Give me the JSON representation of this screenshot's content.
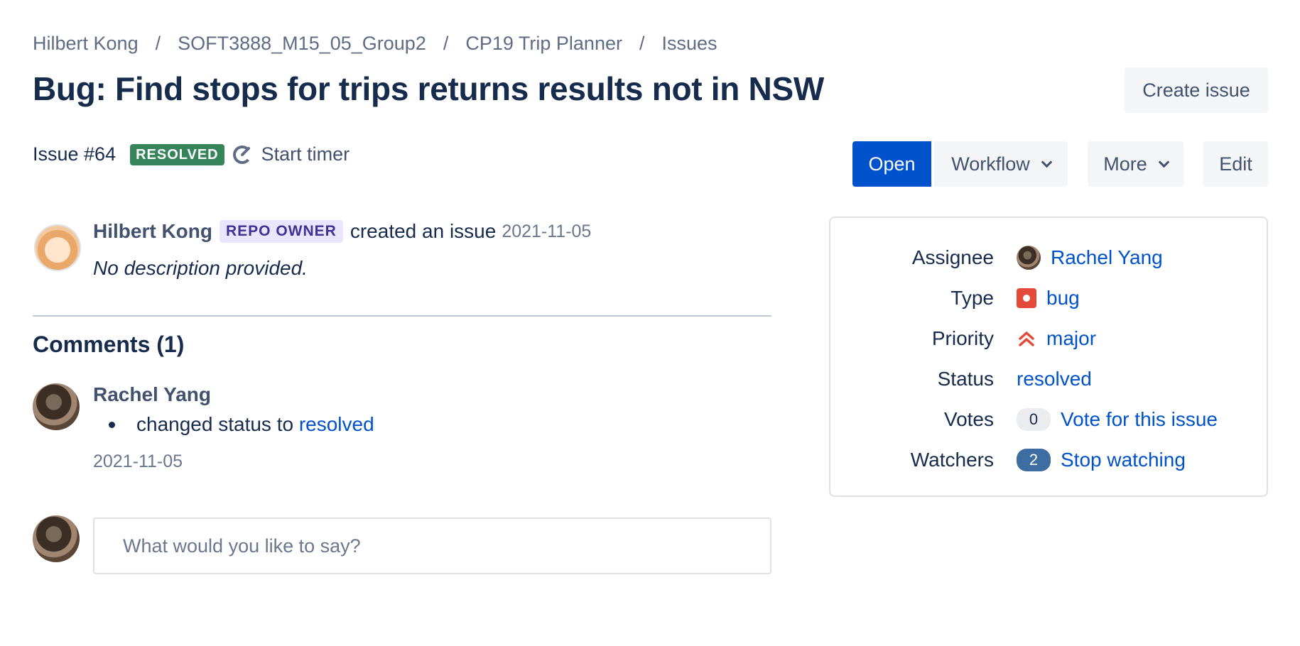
{
  "breadcrumb": [
    {
      "label": "Hilbert Kong"
    },
    {
      "label": "SOFT3888_M15_05_Group2"
    },
    {
      "label": "CP19 Trip Planner"
    },
    {
      "label": "Issues"
    }
  ],
  "breadcrumb_separator": "/",
  "issue": {
    "title": "Bug: Find stops for trips returns results not in NSW",
    "id_label": "Issue #64",
    "status_lozenge": "RESOLVED",
    "timer_label": "Start timer"
  },
  "actions": {
    "create_issue": "Create issue",
    "open": "Open",
    "workflow": "Workflow",
    "more": "More",
    "edit": "Edit"
  },
  "activity": {
    "author": "Hilbert Kong",
    "role_badge": "REPO OWNER",
    "action_text": "created an issue",
    "date": "2021-11-05",
    "description": "No description provided."
  },
  "comments": {
    "heading": "Comments (1)",
    "items": [
      {
        "author": "Rachel Yang",
        "change_prefix": "changed status to",
        "change_value": "resolved",
        "date": "2021-11-05"
      }
    ],
    "input_placeholder": "What would you like to say?"
  },
  "sidebar": {
    "assignee_label": "Assignee",
    "assignee_value": "Rachel Yang",
    "type_label": "Type",
    "type_value": "bug",
    "priority_label": "Priority",
    "priority_value": "major",
    "status_label": "Status",
    "status_value": "resolved",
    "votes_label": "Votes",
    "votes_count": "0",
    "votes_action": "Vote for this issue",
    "watchers_label": "Watchers",
    "watchers_count": "2",
    "watchers_action": "Stop watching"
  },
  "colors": {
    "primary": "#0052cc",
    "resolved_green": "#36855a",
    "owner_badge_bg": "#eae6ff",
    "bug_red": "#e5493a",
    "watchers_badge": "#3d6da1"
  }
}
